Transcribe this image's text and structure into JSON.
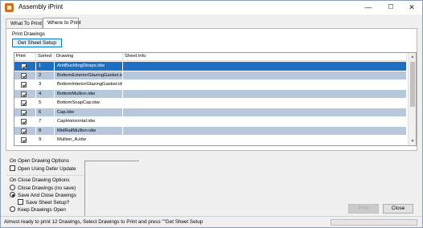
{
  "window": {
    "title": "Assembly iPrint",
    "minimize_glyph": "—",
    "maximize_glyph": "☐",
    "close_glyph": "✕",
    "icon": "app-icon"
  },
  "tabs": [
    {
      "label": "What To Print",
      "active": false
    },
    {
      "label": "Where to Print",
      "active": true
    }
  ],
  "print_drawings": {
    "group_label": "Print Drawings",
    "get_sheet_setup_label": "Get Sheet Setup"
  },
  "grid": {
    "columns": [
      "Print",
      "Sorted",
      "Drawing",
      "Sheet Info"
    ],
    "rows": [
      {
        "checked": true,
        "sorted": "1",
        "drawing": "AntiBucklingStraps.idw",
        "sheet_info": ""
      },
      {
        "checked": true,
        "sorted": "2",
        "drawing": "BottomExteriorGlazingGasket.idw",
        "sheet_info": ""
      },
      {
        "checked": true,
        "sorted": "3",
        "drawing": "BottomInteriorGlazingGasket.idw",
        "sheet_info": ""
      },
      {
        "checked": true,
        "sorted": "4",
        "drawing": "BottomMullion.idw",
        "sheet_info": ""
      },
      {
        "checked": true,
        "sorted": "5",
        "drawing": "BottomSnapCap.idw",
        "sheet_info": ""
      },
      {
        "checked": true,
        "sorted": "6",
        "drawing": "Cap.idw",
        "sheet_info": ""
      },
      {
        "checked": true,
        "sorted": "7",
        "drawing": "CapHorizontal.idw",
        "sheet_info": ""
      },
      {
        "checked": true,
        "sorted": "8",
        "drawing": "MidRailMullion.idw",
        "sheet_info": ""
      },
      {
        "checked": true,
        "sorted": "9",
        "drawing": "Mullion_A.idw",
        "sheet_info": ""
      }
    ],
    "selected_row": 0,
    "scroll_up_glyph": "▲",
    "scroll_down_glyph": "▼"
  },
  "open_options": {
    "group_label": "On Open Drawing Options",
    "defer_update_label": "Open Using Defer Update",
    "defer_update_checked": false
  },
  "close_options": {
    "group_label": "On Close Drawing Options",
    "close_no_save_label": "Close Drawings (no save)",
    "save_and_close_label": "Save And Close Drawings",
    "save_sheet_setup_label": "Save Sheet Setup?",
    "keep_open_label": "Keep Drawings Open",
    "selected": "save_and_close"
  },
  "buttons": {
    "print_label": "Print",
    "close_label": "Close"
  },
  "status": {
    "text": "Almost ready to print 12 Drawings, Select Drawings to Print and press \"\"Get Sheet Setup",
    "progress": 0
  },
  "colors": {
    "selected_row": "#1f6fc3",
    "alt_row": "#b8c8dc",
    "window_bg": "#f0f0f0"
  }
}
